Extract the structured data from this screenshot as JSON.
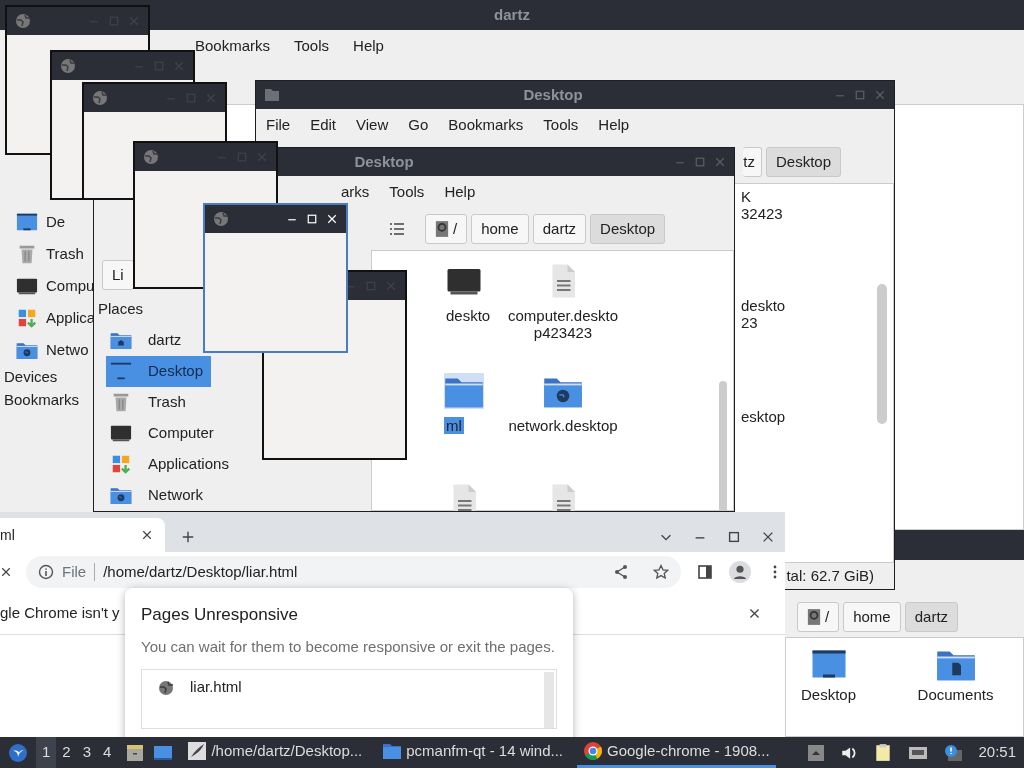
{
  "back_window": {
    "title": "dartz",
    "menu": [
      "Bookmarks",
      "Tools",
      "Help"
    ],
    "places": [
      {
        "label": "De",
        "kind": "desktop"
      },
      {
        "label": "Trash",
        "kind": "trash"
      },
      {
        "label": "Compu",
        "kind": "computer"
      },
      {
        "label": "Applica",
        "kind": "apps"
      },
      {
        "label": "Netwo",
        "kind": "network"
      }
    ],
    "sections": [
      "Devices",
      "Bookmarks"
    ]
  },
  "corner_window": {
    "path": [
      {
        "label": "/",
        "kind": "root",
        "selected": false
      },
      {
        "label": "home",
        "kind": "dir",
        "selected": false
      },
      {
        "label": "dartz",
        "kind": "dir",
        "selected": true
      }
    ],
    "files": [
      {
        "name": "Desktop",
        "kind": "desktop"
      },
      {
        "name": "Documents",
        "kind": "documents"
      }
    ]
  },
  "middle_window": {
    "title": "Desktop",
    "menu": [
      "File",
      "Edit",
      "View",
      "Go",
      "Bookmarks",
      "Tools",
      "Help"
    ],
    "path": [
      {
        "label": "tz",
        "selected": false
      },
      {
        "label": "Desktop",
        "selected": true
      }
    ],
    "file_labels": [
      {
        "lines": [
          "K",
          "32423"
        ]
      },
      {
        "lines": [
          "deskto",
          "23"
        ]
      },
      {
        "lines": [
          "esktop"
        ]
      }
    ],
    "status": "tal: 62.7 GiB)"
  },
  "front_window": {
    "title": "Desktop",
    "menu": [
      "arks",
      "Tools",
      "Help"
    ],
    "path": [
      {
        "label": "/",
        "kind": "root",
        "selected": false
      },
      {
        "label": "home",
        "kind": "dir",
        "selected": false
      },
      {
        "label": "dartz",
        "kind": "dir",
        "selected": false
      },
      {
        "label": "Desktop",
        "kind": "dir",
        "selected": true
      }
    ],
    "side_tab": "Li",
    "places_heading": "Places",
    "places": [
      {
        "label": "dartz",
        "kind": "home",
        "selected": false
      },
      {
        "label": "Desktop",
        "kind": "desktop",
        "selected": true
      },
      {
        "label": "Trash",
        "kind": "trash",
        "selected": false
      },
      {
        "label": "Computer",
        "kind": "computer",
        "selected": false
      },
      {
        "label": "Applications",
        "kind": "apps",
        "selected": false
      },
      {
        "label": "Network",
        "kind": "network",
        "selected": false
      }
    ],
    "files": [
      {
        "lines": [
          "deskto"
        ],
        "kind": "computer",
        "selected": false
      },
      {
        "lines": [
          "computer.deskto",
          "p423423"
        ],
        "kind": "document",
        "selected": false
      },
      {
        "lines": [
          "ml"
        ],
        "kind": "folder",
        "selected": true
      },
      {
        "lines": [
          "network.desktop"
        ],
        "kind": "network",
        "selected": false
      },
      {
        "kind": "document",
        "selected": false
      },
      {
        "kind": "document",
        "selected": false
      }
    ]
  },
  "blank_windows": [
    {
      "focused": false
    },
    {
      "focused": false
    },
    {
      "focused": false
    },
    {
      "focused": false
    },
    {
      "focused": false
    },
    {
      "focused": true
    }
  ],
  "browser": {
    "tab": "ml",
    "scheme": "File",
    "url": "/home/dartz/Desktop/liar.html",
    "infobar": "gle Chrome isn't y",
    "dialog": {
      "title": "Pages Unresponsive",
      "message": "You can wait for them to become responsive or exit the pages.",
      "pages": [
        "liar.html"
      ]
    }
  },
  "taskbar": {
    "workspaces": [
      {
        "label": "1",
        "selected": true
      },
      {
        "label": "2",
        "selected": false
      },
      {
        "label": "3",
        "selected": false
      },
      {
        "label": "4",
        "selected": false
      }
    ],
    "tasks": [
      {
        "label": "/home/dartz/Desktop...",
        "kind": "editor",
        "selected": false
      },
      {
        "label": "pcmanfm-qt - 14 wind...",
        "kind": "folder",
        "selected": false
      },
      {
        "label": "Google-chrome - 1908...",
        "kind": "browser",
        "selected": true
      }
    ],
    "clock": "20:51"
  }
}
